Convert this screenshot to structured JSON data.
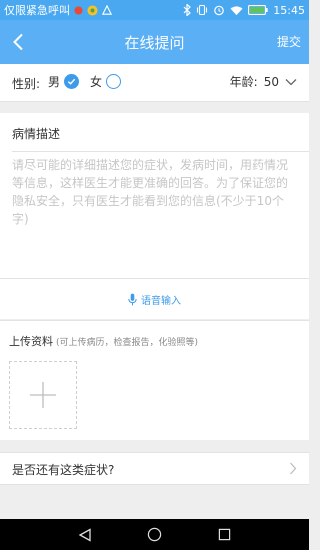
{
  "status_bar": {
    "carrier_text": "仅限紧急呼叫",
    "time": "15:45",
    "icons": [
      "emergency-dot-icon",
      "app-notification-icon",
      "alert-triangle-icon",
      "bluetooth-icon",
      "vibrate-icon",
      "alarm-icon",
      "wifi-icon",
      "battery-icon"
    ]
  },
  "nav": {
    "back_icon": "chevron-left-icon",
    "title": "在线提问",
    "submit_label": "提交"
  },
  "patient": {
    "gender_label": "性别:",
    "male_label": "男",
    "female_label": "女",
    "selected_gender": "男",
    "age_label": "年龄:",
    "age_value": "50"
  },
  "description": {
    "label": "病情描述",
    "value": "",
    "placeholder": "请尽可能的详细描述您的症状，发病时间，用药情况等信息，这样医生才能更准确的回答。为了保证您的隐私安全，只有医生才能看到您的信息(不少于10个字)",
    "voice_label": "语音输入"
  },
  "upload": {
    "title": "上传资料",
    "hint": "(可上传病历，检查报告，化验照等)"
  },
  "symptom": {
    "label": "是否还有这类症状?"
  },
  "system_nav": {
    "icons": [
      "back-triangle-icon",
      "home-circle-icon",
      "recents-square-icon"
    ]
  },
  "colors": {
    "status_bar": "#4aa8f0",
    "nav_bar": "#5bb0f5",
    "accent": "#3d9be9",
    "background": "#eeeeee"
  }
}
